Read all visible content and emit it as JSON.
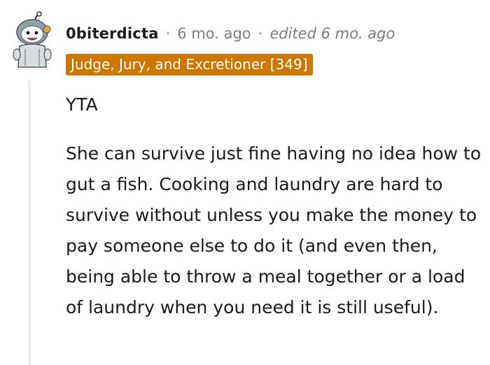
{
  "comment": {
    "username": "0biterdicta",
    "separator": "·",
    "time": "6 mo. ago",
    "edited": "edited 6 mo. ago",
    "flair": "Judge, Jury, and Excretioner [349]",
    "paragraphs": [
      "YTA",
      "She can survive just fine having no idea how to gut a fish. Cooking and laundry are hard to survive without unless you make the money to pay someone else to do it (and even then, being able to throw a meal together or a load of laundry when you need it is still useful)."
    ]
  },
  "colors": {
    "flair_background": "#cc7700",
    "flair_text": "#ffffff",
    "meta_text": "#7c7c7c",
    "thread_line": "#edeff1"
  },
  "icons": {
    "avatar": "snoo-avatar-icon"
  }
}
